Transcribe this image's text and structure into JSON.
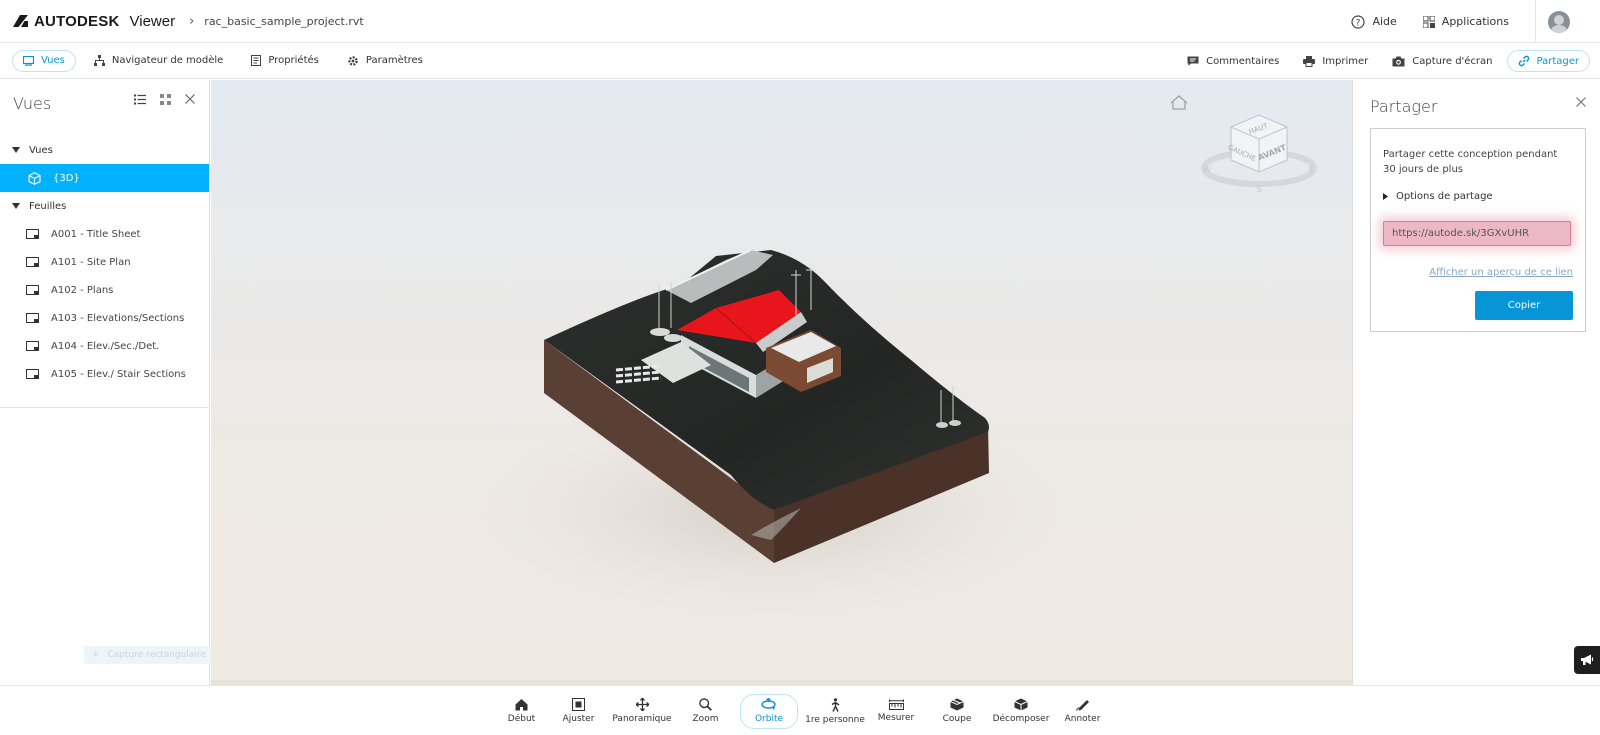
{
  "header": {
    "brand": "AUTODESK",
    "product": "Viewer",
    "file_name": "rac_basic_sample_project.rvt",
    "help_label": "Aide",
    "apps_label": "Applications"
  },
  "toolbar": {
    "left": [
      {
        "label": "Vues",
        "icon": "views-icon",
        "active": true
      },
      {
        "label": "Navigateur de modèle",
        "icon": "model-browser-icon"
      },
      {
        "label": "Propriétés",
        "icon": "properties-icon"
      },
      {
        "label": "Paramètres",
        "icon": "settings-gear-icon"
      }
    ],
    "right": [
      {
        "label": "Commentaires",
        "icon": "comment-icon"
      },
      {
        "label": "Imprimer",
        "icon": "printer-icon"
      },
      {
        "label": "Capture d'écran",
        "icon": "camera-icon"
      },
      {
        "label": "Partager",
        "icon": "link-icon",
        "active": true
      }
    ]
  },
  "left_panel": {
    "title": "Vues",
    "groups": [
      {
        "label": "Vues",
        "items": [
          {
            "label": "{3D}",
            "selected": true
          }
        ]
      },
      {
        "label": "Feuilles",
        "items": [
          {
            "label": "A001 - Title Sheet"
          },
          {
            "label": "A101 - Site Plan"
          },
          {
            "label": "A102 - Plans"
          },
          {
            "label": "A103 - Elevations/Sections"
          },
          {
            "label": "A104 - Elev./Sec./Det."
          },
          {
            "label": "A105 - Elev./ Stair Sections"
          }
        ]
      }
    ],
    "ghost_toast": "Capture rectangulaire"
  },
  "viewcube": {
    "top": "HAUT",
    "left": "GAUCHE",
    "front": "AVANT",
    "west": "W",
    "south": "S",
    "east": "E"
  },
  "share_panel": {
    "title": "Partager",
    "description": "Partager cette conception pendant 30 jours de plus",
    "options_label": "Options de partage",
    "url": "https://autode.sk/3GXvUHR",
    "preview_link": "Afficher un aperçu de ce lien",
    "copy_label": "Copier"
  },
  "bottom_tools": [
    {
      "label": "Début",
      "icon": "home-icon"
    },
    {
      "label": "Ajuster",
      "icon": "fit-icon"
    },
    {
      "label": "Panoramique",
      "icon": "pan-icon"
    },
    {
      "label": "Zoom",
      "icon": "zoom-icon"
    },
    {
      "label": "Orbite",
      "icon": "orbit-icon",
      "active": true
    },
    {
      "label": "1re personne",
      "icon": "first-person-icon"
    },
    {
      "label": "Mesurer",
      "icon": "measure-icon"
    },
    {
      "label": "Coupe",
      "icon": "section-icon"
    },
    {
      "label": "Décomposer",
      "icon": "explode-icon"
    },
    {
      "label": "Annoter",
      "icon": "markup-icon"
    }
  ],
  "colors": {
    "accent": "#0696d7",
    "selection": "#00b2ff",
    "roof_highlight": "#e8151d",
    "terrain_top": "#2a2d2a",
    "terrain_side": "#5a4034"
  }
}
